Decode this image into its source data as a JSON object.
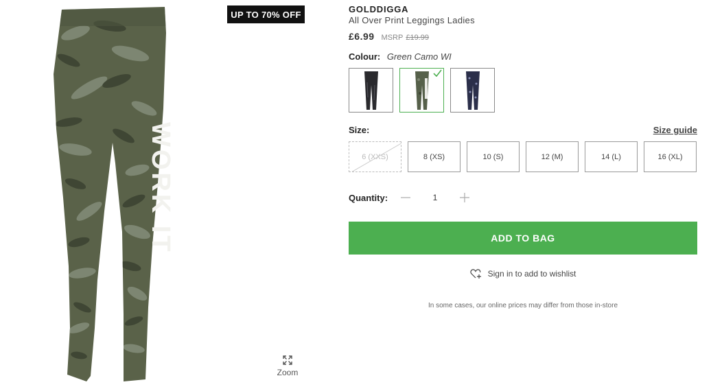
{
  "promo": {
    "badge": "UP TO 70% OFF"
  },
  "product": {
    "brand": "GOLDDIGGA",
    "name": "All Over Print Leggings Ladies",
    "price": "£6.99",
    "msrp_label": "MSRP",
    "msrp_value": "£19.99"
  },
  "image": {
    "print_text": "WORK IT"
  },
  "zoom": {
    "label": "Zoom",
    "icon": "expand-icon"
  },
  "colour": {
    "label": "Colour:",
    "selected": "Green Camo WI",
    "swatches": [
      {
        "name": "Black",
        "color": "#2a2a2e",
        "selected": false
      },
      {
        "name": "Green Camo WI",
        "color": "#56604a",
        "selected": true
      },
      {
        "name": "Navy Print",
        "color": "#2b2f4a",
        "selected": false
      }
    ]
  },
  "size": {
    "label": "Size:",
    "guide_label": "Size guide",
    "options": [
      {
        "label": "6 (XXS)",
        "available": false
      },
      {
        "label": "8 (XS)",
        "available": true
      },
      {
        "label": "10 (S)",
        "available": true
      },
      {
        "label": "12 (M)",
        "available": true
      },
      {
        "label": "14 (L)",
        "available": true
      },
      {
        "label": "16 (XL)",
        "available": true
      }
    ]
  },
  "quantity": {
    "label": "Quantity:",
    "value": "1",
    "minus_icon": "minus-icon",
    "plus_icon": "plus-icon"
  },
  "add_to_bag": {
    "label": "ADD TO BAG",
    "color": "#4caf50"
  },
  "wishlist": {
    "label": "Sign in to add to wishlist",
    "icon": "heart-plus-icon"
  },
  "disclaimer": "In some cases, our online prices may differ from those in-store"
}
